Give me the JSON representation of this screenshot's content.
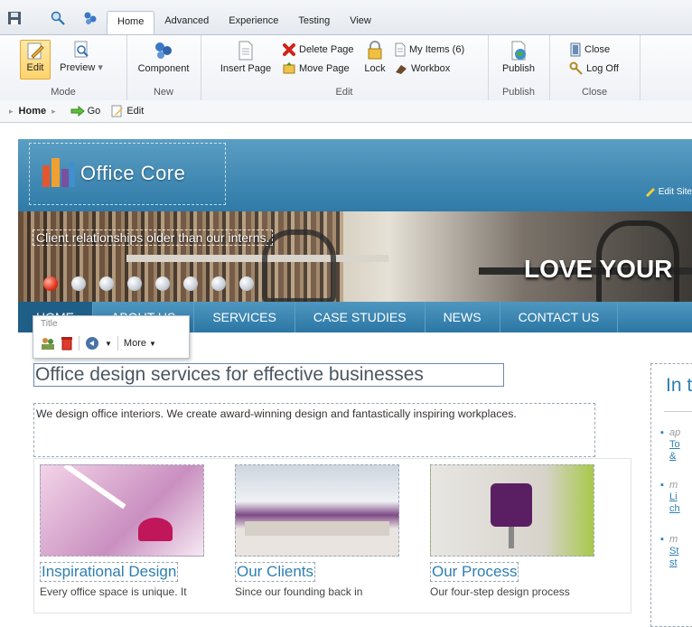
{
  "ribbon": {
    "tabs": [
      "Home",
      "Advanced",
      "Experience",
      "Testing",
      "View"
    ],
    "groups": {
      "mode": {
        "label": "Mode",
        "edit": "Edit",
        "preview": "Preview"
      },
      "new": {
        "label": "New",
        "component": "Component"
      },
      "edit": {
        "label": "Edit",
        "insert_page": "Insert Page",
        "delete_page": "Delete Page",
        "move_page": "Move Page",
        "lock": "Lock",
        "my_items": "My Items (6)",
        "workbox": "Workbox"
      },
      "publish": {
        "label": "Publish",
        "publish": "Publish"
      },
      "close": {
        "label": "Close",
        "close": "Close",
        "log_off": "Log Off"
      }
    }
  },
  "address": {
    "home": "Home",
    "go": "Go",
    "edit": "Edit"
  },
  "site": {
    "logo": "Office Core",
    "edit_site": "Edit Site",
    "banner_tag": "Client relationships older than our interns.",
    "banner_big": "LOVE YOUR",
    "slides": 8,
    "active_slide": 1,
    "nav": [
      "HOME",
      "ABOUT US",
      "SERVICES",
      "CASE STUDIES",
      "NEWS",
      "CONTACT US"
    ],
    "chrome": {
      "label": "Title",
      "more": "More"
    },
    "heading": "Office design services for effective businesses",
    "intro": "We design office interiors. We create award-winning design and fantastically inspiring workplaces.",
    "cards": [
      {
        "title": "Inspirational Design",
        "text": "Every office space is unique. It"
      },
      {
        "title": "Our Clients",
        "text": "Since our founding back in"
      },
      {
        "title": "Our Process",
        "text": "Our four-step design process"
      }
    ],
    "sidebar": {
      "title": "In t",
      "items": [
        {
          "meta": "ap",
          "lines": [
            "To",
            "& "
          ]
        },
        {
          "meta": "m",
          "lines": [
            "Li",
            "ch"
          ]
        },
        {
          "meta": "m",
          "lines": [
            "St",
            "st"
          ]
        }
      ]
    }
  },
  "colors": {
    "accent": "#2e7fb0",
    "nav": "#2b76a4",
    "ribbon": "#eef1f6"
  }
}
